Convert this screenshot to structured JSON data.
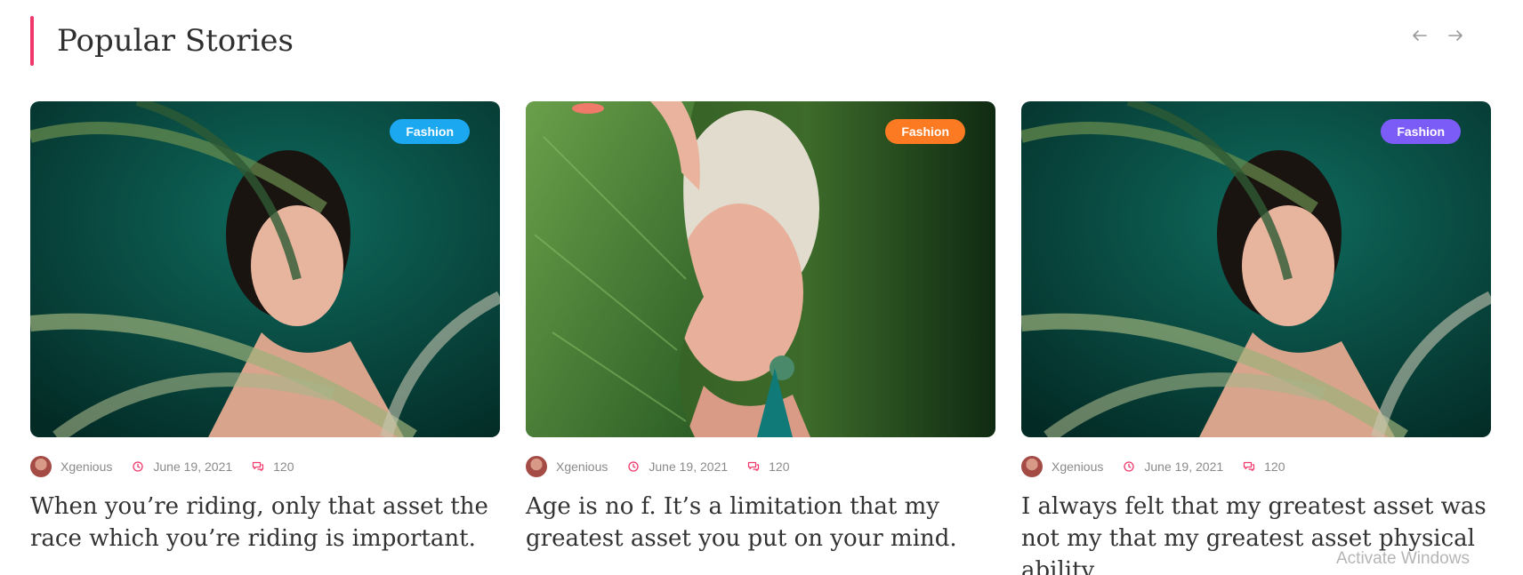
{
  "section": {
    "title": "Popular Stories",
    "accent_color": "#f0386b"
  },
  "navigation": {
    "prev_icon": "arrow-left-icon",
    "next_icon": "arrow-right-icon"
  },
  "cards": [
    {
      "tag": "Fashion",
      "tag_color": "#1ba8f0",
      "image": "woman-with-palm-leaves",
      "author": "Xgenious",
      "date": "June 19, 2021",
      "comments": "120",
      "title": "When you’re riding, only that asset the race which you’re riding is important."
    },
    {
      "tag": "Fashion",
      "tag_color": "#fb7a22",
      "image": "blonde-woman-behind-leaf",
      "author": "Xgenious",
      "date": "June 19, 2021",
      "comments": "120",
      "title": "Age is no f. It’s a limitation that my greatest asset you put on your mind."
    },
    {
      "tag": "Fashion",
      "tag_color": "#7b5cf6",
      "image": "woman-with-palm-leaves",
      "author": "Xgenious",
      "date": "June 19, 2021",
      "comments": "120",
      "title": "I always felt that my greatest asset was not my that my greatest asset physical ability"
    }
  ],
  "overlay": {
    "watermark": "Activate Windows"
  }
}
